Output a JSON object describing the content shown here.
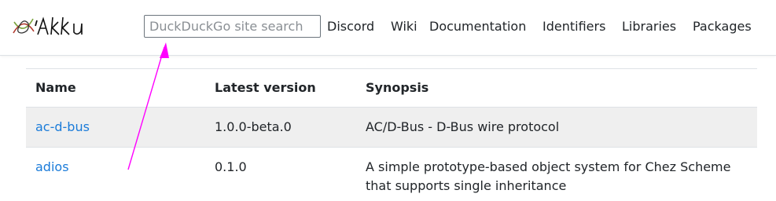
{
  "header": {
    "logo_alt": "Akku",
    "search": {
      "placeholder": "DuckDuckGo site search",
      "value": ""
    },
    "nav": [
      "Discord",
      "Wiki",
      "Documentation",
      "Identifiers",
      "Libraries",
      "Packages"
    ]
  },
  "table": {
    "columns": [
      "Name",
      "Latest version",
      "Synopsis"
    ],
    "rows": [
      {
        "name": "ac-d-bus",
        "version": "1.0.0-beta.0",
        "synopsis": "AC/D-Bus - D-Bus wire protocol"
      },
      {
        "name": "adios",
        "version": "0.1.0",
        "synopsis": "A simple prototype-based object system for Chez Scheme that supports single inheritance"
      }
    ]
  },
  "colors": {
    "link": "#1a7bd9",
    "annotation": "#ff00ff",
    "stripe": "#efefef"
  }
}
